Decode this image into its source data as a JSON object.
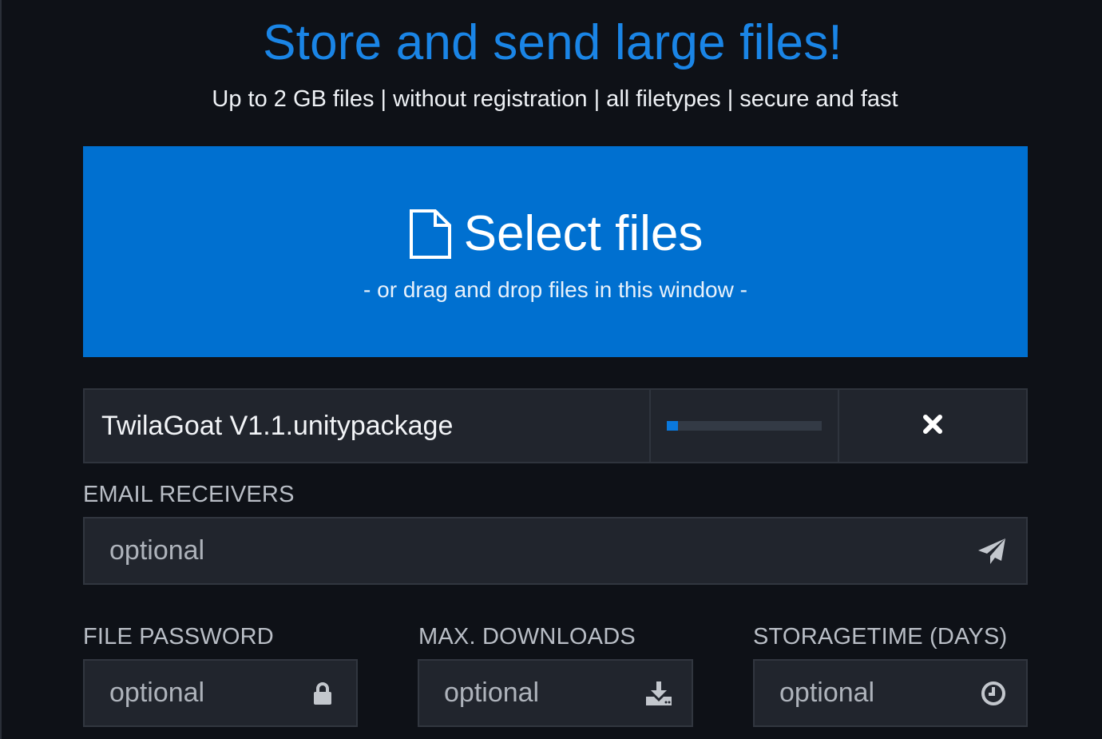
{
  "header": {
    "title": "Store and send large files!",
    "subtitle": "Up to 2 GB files | without registration | all filetypes | secure and fast"
  },
  "dropzone": {
    "icon": "file-icon",
    "title": "Select files",
    "subtitle": "- or drag and drop files in this window -"
  },
  "upload": {
    "file_name": "TwilaGoat V1.1.unitypackage",
    "progress_fraction": 0.07,
    "remove_icon": "close-icon"
  },
  "email": {
    "label": "EMAIL RECEIVERS",
    "placeholder": "optional",
    "icon": "send-icon"
  },
  "password": {
    "label": "FILE PASSWORD",
    "placeholder": "optional",
    "icon": "lock-icon"
  },
  "downloads": {
    "label": "MAX. DOWNLOADS",
    "placeholder": "optional",
    "icon": "download-icon"
  },
  "storage": {
    "label": "STORAGETIME (DAYS)",
    "placeholder": "optional",
    "icon": "clock-icon"
  },
  "colors": {
    "background": "#0e1117",
    "accent": "#0070d0",
    "title": "#1a85e6",
    "field": "#21252d"
  }
}
